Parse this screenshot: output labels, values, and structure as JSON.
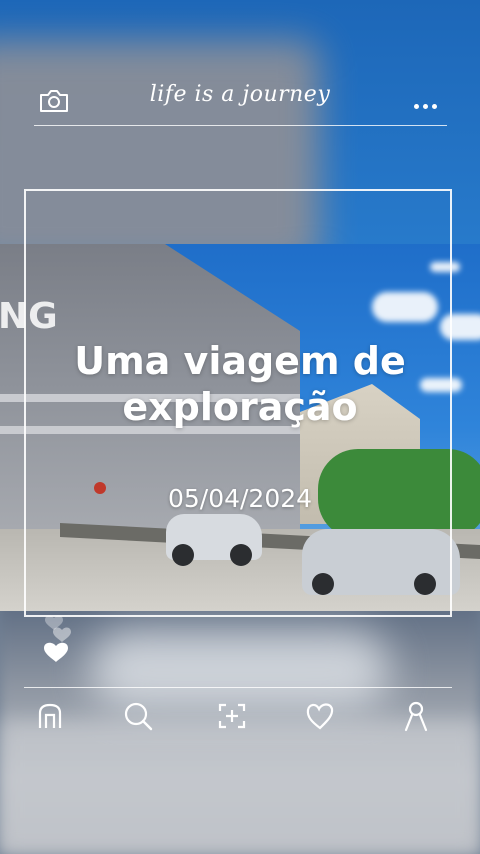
{
  "header": {
    "title": "life is a journey",
    "left_icon": "camera-icon",
    "right_icon": "more-icon"
  },
  "photo": {
    "title_line1": "Uma viagem de",
    "title_line2": "exploração",
    "date": "05/04/2024",
    "signage_text": "NG"
  },
  "decorations": {
    "hearts": "heart-icon"
  },
  "nav": {
    "items": [
      "home-icon",
      "search-icon",
      "scan-add-icon",
      "heart-icon",
      "profile-icon"
    ]
  },
  "colors": {
    "accent": "#ffffff",
    "sky": "#2a7fd0"
  }
}
